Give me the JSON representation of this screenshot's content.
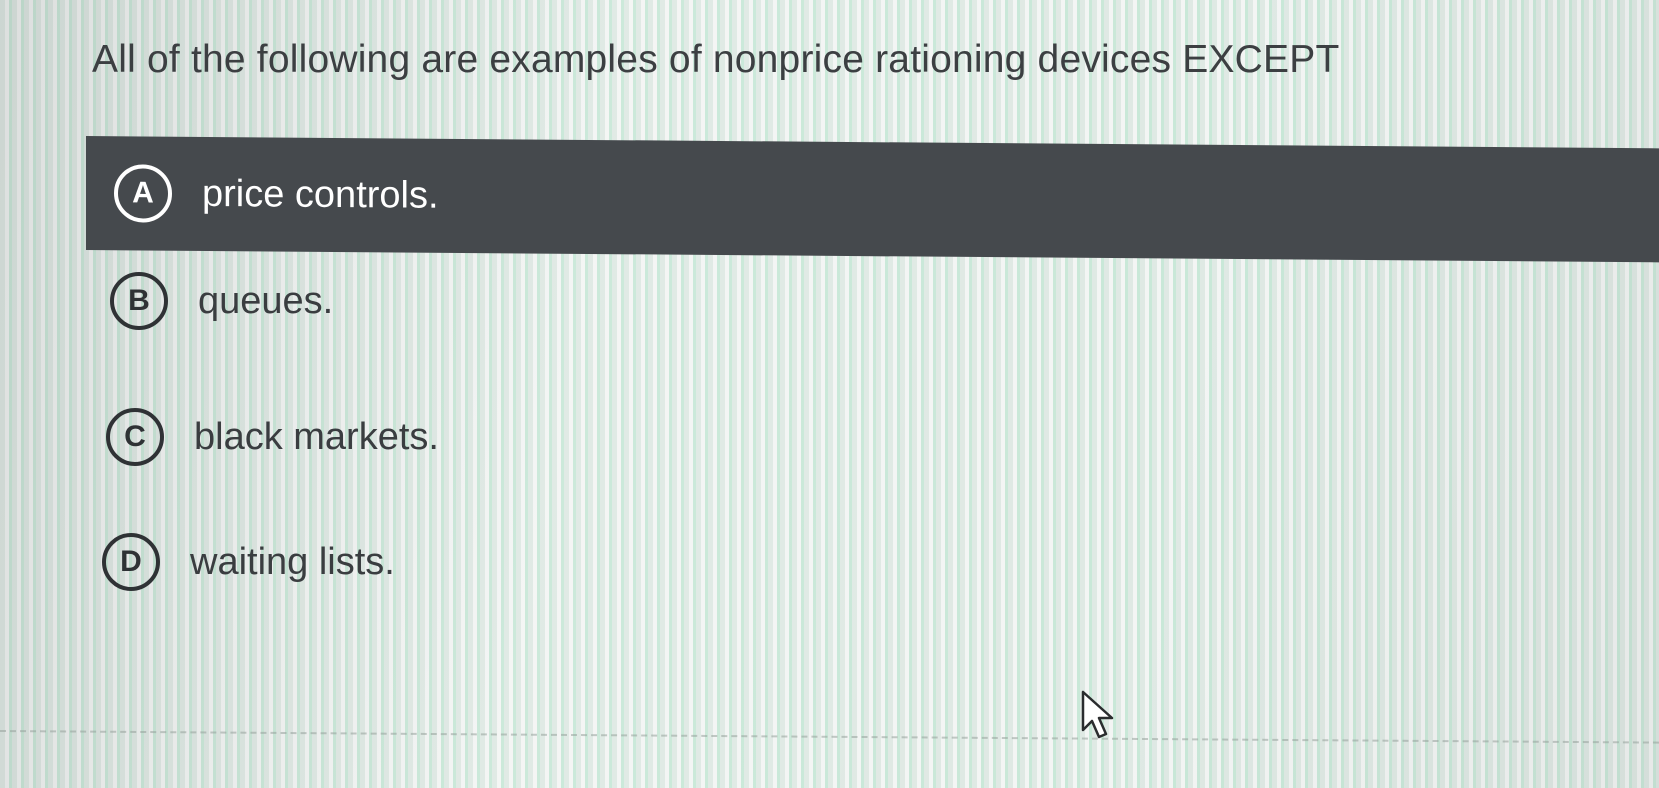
{
  "question": {
    "text": "All of the following are examples of nonprice rationing devices EXCEPT"
  },
  "options": [
    {
      "letter": "A",
      "text": "price controls.",
      "selected": true
    },
    {
      "letter": "B",
      "text": "queues.",
      "selected": false
    },
    {
      "letter": "C",
      "text": "black markets.",
      "selected": false
    },
    {
      "letter": "D",
      "text": "waiting lists.",
      "selected": false
    }
  ],
  "colors": {
    "selected_bg": "#45494d",
    "text": "#3a3d40",
    "stripe_green": "#c9e8d8"
  },
  "icons": {
    "cursor": "mouse-pointer-icon"
  }
}
